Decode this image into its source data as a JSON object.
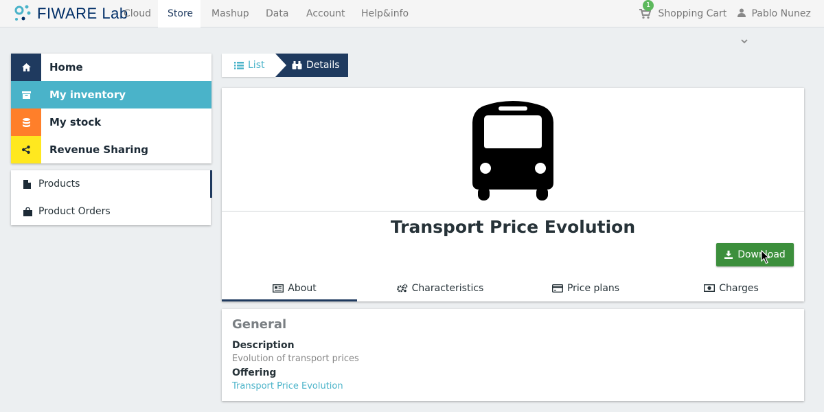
{
  "brand": {
    "name": "FIWARE",
    "suffix": "Lab"
  },
  "nav": {
    "items": [
      {
        "label": "Cloud"
      },
      {
        "label": "Store",
        "active": true
      },
      {
        "label": "Mashup"
      },
      {
        "label": "Data"
      },
      {
        "label": "Account"
      },
      {
        "label": "Help&info"
      }
    ],
    "cart": {
      "label": "Shopping Cart",
      "count": "1"
    },
    "user": {
      "name": "Pablo Nunez"
    }
  },
  "menu": {
    "items": [
      {
        "label": "Home",
        "icon": "home-icon",
        "color": "#1f3a5f"
      },
      {
        "label": "My inventory",
        "icon": "archive-icon",
        "color": "#4ab3c9"
      },
      {
        "label": "My stock",
        "icon": "database-icon",
        "color": "#ff7f2a"
      },
      {
        "label": "Revenue Sharing",
        "icon": "share-icon",
        "color": "#ffe81f"
      }
    ],
    "sub_items": [
      {
        "label": "Products",
        "icon": "file-icon",
        "active": true
      },
      {
        "label": "Product Orders",
        "icon": "shopping-bag-icon"
      }
    ]
  },
  "breadcrumb": {
    "list": "List",
    "details": "Details"
  },
  "product": {
    "title": "Transport Price Evolution",
    "download_label": "Download",
    "tabs": [
      {
        "label": "About",
        "icon": "newspaper-icon",
        "active": true
      },
      {
        "label": "Characteristics",
        "icon": "gears-icon"
      },
      {
        "label": "Price plans",
        "icon": "credit-card-icon"
      },
      {
        "label": "Charges",
        "icon": "money-icon"
      }
    ]
  },
  "general": {
    "heading": "General",
    "description_label": "Description",
    "description": "Evolution of transport prices",
    "offering_label": "Offering",
    "offering": "Transport Price Evolution"
  },
  "colors": {
    "navy": "#1f3a5f",
    "teal": "#4ab3c9",
    "green": "#3c8f3c"
  }
}
